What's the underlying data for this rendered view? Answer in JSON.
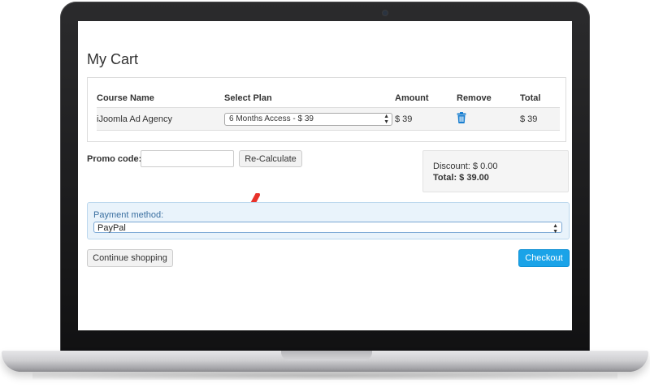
{
  "page": {
    "title": "My Cart"
  },
  "cart": {
    "columns": [
      "Course Name",
      "Select Plan",
      "Amount",
      "Remove",
      "Total"
    ],
    "rows": [
      {
        "course_name": "iJoomla Ad Agency",
        "plan": "6 Months Access - $ 39",
        "amount": "$ 39",
        "total": "$ 39",
        "remove_icon": "trash-icon"
      }
    ]
  },
  "promo": {
    "label": "Promo code:",
    "value": "",
    "button_label": "Re-Calculate"
  },
  "summary": {
    "discount": "Discount: $ 0.00",
    "total": "Total: $ 39.00"
  },
  "payment": {
    "label": "Payment method:",
    "selected": "PayPal"
  },
  "actions": {
    "continue_label": "Continue shopping",
    "checkout_label": "Checkout"
  },
  "colors": {
    "checkout": "#1aa3e8",
    "payment_panel": "#e9f3fb",
    "trash_icon": "#1a7fd0",
    "annotation_arrow": "#e8322a"
  }
}
